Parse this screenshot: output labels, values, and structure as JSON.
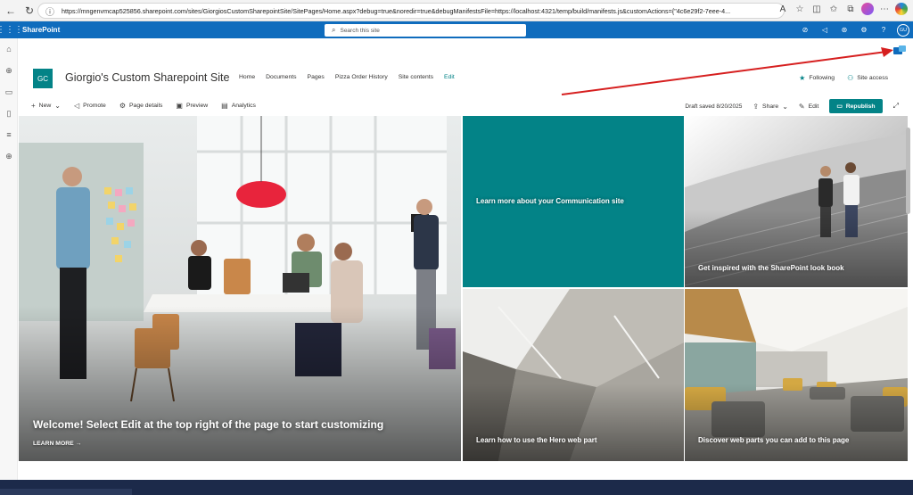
{
  "browser": {
    "url": "https://mngenvmcap525856.sharepoint.com/sites/GiorgiosCustomSharepointSite/SitePages/Home.aspx?debug=true&noredir=true&debugManifestsFile=https://localhost:4321/temp/build/manifests.js&customActions={\"4c6e29f2-7eee-4..."
  },
  "suite": {
    "app_name": "SharePoint",
    "search_placeholder": "Search this site",
    "user_initials": "GU"
  },
  "site": {
    "logo_initials": "GC",
    "title": "Giorgio's Custom Sharepoint Site",
    "nav": [
      "Home",
      "Documents",
      "Pages",
      "Pizza Order History",
      "Site contents",
      "Edit"
    ],
    "following_label": "Following",
    "site_access_label": "Site access"
  },
  "command_bar": {
    "new_label": "New",
    "promote_label": "Promote",
    "page_details_label": "Page details",
    "preview_label": "Preview",
    "analytics_label": "Analytics",
    "draft_status": "Draft saved 8/20/2025",
    "share_label": "Share",
    "edit_label": "Edit",
    "republish_label": "Republish"
  },
  "hero": {
    "main_title": "Welcome! Select Edit at the top right of the page to start customizing",
    "learn_more": "LEARN MORE →",
    "tiles": [
      "Learn more about your Communication site",
      "Get inspired with the SharePoint look book",
      "Learn how to use the Hero web part",
      "Discover web parts you can add to this page"
    ]
  },
  "colors": {
    "suite_bar": "#0f6cbd",
    "accent": "#038387",
    "annotation_arrow": "#d61f1f"
  }
}
